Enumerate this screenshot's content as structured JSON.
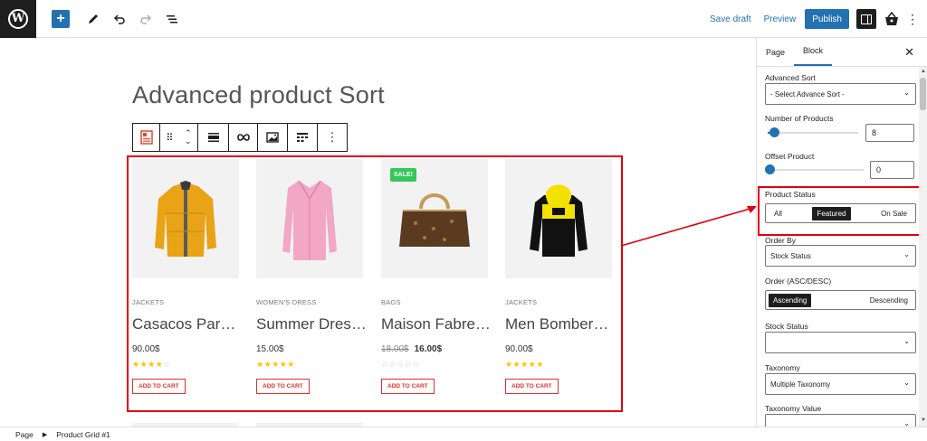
{
  "header": {
    "add_symbol": "+",
    "save_draft": "Save draft",
    "preview": "Preview",
    "publish": "Publish",
    "more_symbol": "⋮",
    "colors": {
      "accent": "#2271b1",
      "dark": "#1e1e1e"
    }
  },
  "editor": {
    "page_title": "Advanced product Sort",
    "products": [
      {
        "category": "JACKETS",
        "name": "Casacos Parka…",
        "price": "90.00$",
        "old_price": "",
        "rating": 4,
        "sale": false,
        "image": "yellow-jacket"
      },
      {
        "category": "WOMEN'S DRESS",
        "name": "Summer Dres…",
        "price": "15.00$",
        "old_price": "",
        "rating": 5,
        "sale": false,
        "image": "pink-shirt"
      },
      {
        "category": "BAGS",
        "name": "Maison Fabre…",
        "price": "16.00$",
        "old_price": "18.00$",
        "rating": 0,
        "sale": true,
        "image": "brown-handbag"
      },
      {
        "category": "JACKETS",
        "name": "Men Bomber…",
        "price": "90.00$",
        "old_price": "",
        "rating": 5,
        "sale": false,
        "image": "black-yellow-hoodie"
      }
    ],
    "sale_badge": "SALE!",
    "cart_label": "ADD TO CART",
    "highlight_color": "#e3000f"
  },
  "sidebar": {
    "tabs": [
      "Page",
      "Block"
    ],
    "active_tab": "Block",
    "close_symbol": "✕",
    "advanced_sort": {
      "label": "Advanced Sort",
      "value": "- Select Advance Sort -"
    },
    "num_products": {
      "label": "Number of Products",
      "value": "8"
    },
    "offset_product": {
      "label": "Offset Product",
      "value": "0"
    },
    "product_status": {
      "label": "Product Status",
      "options": [
        "All",
        "Featured",
        "On Sale"
      ],
      "selected": "Featured"
    },
    "order_by": {
      "label": "Order By",
      "value": "Stock Status"
    },
    "order_dir": {
      "label": "Order (ASC/DESC)",
      "options": [
        "Ascending",
        "Descending"
      ],
      "selected": "Ascending"
    },
    "stock_status": {
      "label": "Stock Status",
      "value": ""
    },
    "taxonomy": {
      "label": "Taxonomy",
      "value": "Multiple Taxonomy"
    },
    "taxonomy_value": {
      "label": "Taxonomy Value"
    }
  },
  "footer": {
    "crumb_1": "Page",
    "crumb_2": "Product Grid #1",
    "separator": "▶"
  }
}
